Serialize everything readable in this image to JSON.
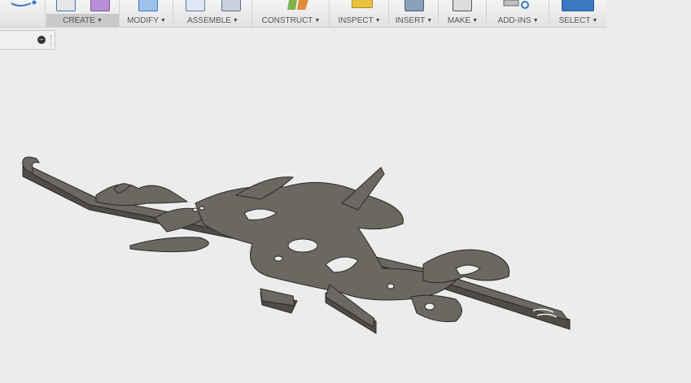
{
  "toolbar": {
    "groups": [
      {
        "label": "CREATE"
      },
      {
        "label": "MODIFY"
      },
      {
        "label": "ASSEMBLE"
      },
      {
        "label": "CONSTRUCT"
      },
      {
        "label": "INSPECT"
      },
      {
        "label": "INSERT"
      },
      {
        "label": "MAKE"
      },
      {
        "label": "ADD-INS"
      },
      {
        "label": "SELECT"
      }
    ],
    "caret": "▼"
  },
  "browser": {
    "collapse_symbol": "–"
  },
  "colors": {
    "model_top": "#6b6862",
    "model_side": "#4f4c47",
    "model_edge": "#2a2926",
    "background": "#ececec",
    "select_icon": "#3b78c2"
  },
  "icons": [
    "sketch-icon",
    "create-box-icon",
    "create-form-icon",
    "modify-press-pull-icon",
    "new-component-icon",
    "joint-icon",
    "offset-plane-icon",
    "measure-icon",
    "insert-canvas-icon",
    "3d-print-icon",
    "scripts-icon",
    "select-cursor-icon"
  ]
}
